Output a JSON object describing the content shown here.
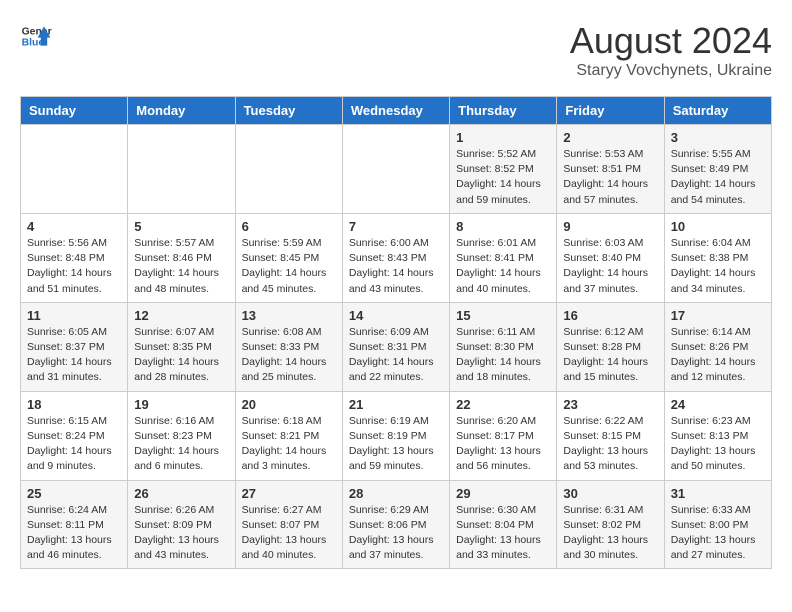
{
  "header": {
    "logo_line1": "General",
    "logo_line2": "Blue",
    "month": "August 2024",
    "location": "Staryy Vovchynets, Ukraine"
  },
  "weekdays": [
    "Sunday",
    "Monday",
    "Tuesday",
    "Wednesday",
    "Thursday",
    "Friday",
    "Saturday"
  ],
  "weeks": [
    [
      {
        "day": "",
        "info": ""
      },
      {
        "day": "",
        "info": ""
      },
      {
        "day": "",
        "info": ""
      },
      {
        "day": "",
        "info": ""
      },
      {
        "day": "1",
        "info": "Sunrise: 5:52 AM\nSunset: 8:52 PM\nDaylight: 14 hours\nand 59 minutes."
      },
      {
        "day": "2",
        "info": "Sunrise: 5:53 AM\nSunset: 8:51 PM\nDaylight: 14 hours\nand 57 minutes."
      },
      {
        "day": "3",
        "info": "Sunrise: 5:55 AM\nSunset: 8:49 PM\nDaylight: 14 hours\nand 54 minutes."
      }
    ],
    [
      {
        "day": "4",
        "info": "Sunrise: 5:56 AM\nSunset: 8:48 PM\nDaylight: 14 hours\nand 51 minutes."
      },
      {
        "day": "5",
        "info": "Sunrise: 5:57 AM\nSunset: 8:46 PM\nDaylight: 14 hours\nand 48 minutes."
      },
      {
        "day": "6",
        "info": "Sunrise: 5:59 AM\nSunset: 8:45 PM\nDaylight: 14 hours\nand 45 minutes."
      },
      {
        "day": "7",
        "info": "Sunrise: 6:00 AM\nSunset: 8:43 PM\nDaylight: 14 hours\nand 43 minutes."
      },
      {
        "day": "8",
        "info": "Sunrise: 6:01 AM\nSunset: 8:41 PM\nDaylight: 14 hours\nand 40 minutes."
      },
      {
        "day": "9",
        "info": "Sunrise: 6:03 AM\nSunset: 8:40 PM\nDaylight: 14 hours\nand 37 minutes."
      },
      {
        "day": "10",
        "info": "Sunrise: 6:04 AM\nSunset: 8:38 PM\nDaylight: 14 hours\nand 34 minutes."
      }
    ],
    [
      {
        "day": "11",
        "info": "Sunrise: 6:05 AM\nSunset: 8:37 PM\nDaylight: 14 hours\nand 31 minutes."
      },
      {
        "day": "12",
        "info": "Sunrise: 6:07 AM\nSunset: 8:35 PM\nDaylight: 14 hours\nand 28 minutes."
      },
      {
        "day": "13",
        "info": "Sunrise: 6:08 AM\nSunset: 8:33 PM\nDaylight: 14 hours\nand 25 minutes."
      },
      {
        "day": "14",
        "info": "Sunrise: 6:09 AM\nSunset: 8:31 PM\nDaylight: 14 hours\nand 22 minutes."
      },
      {
        "day": "15",
        "info": "Sunrise: 6:11 AM\nSunset: 8:30 PM\nDaylight: 14 hours\nand 18 minutes."
      },
      {
        "day": "16",
        "info": "Sunrise: 6:12 AM\nSunset: 8:28 PM\nDaylight: 14 hours\nand 15 minutes."
      },
      {
        "day": "17",
        "info": "Sunrise: 6:14 AM\nSunset: 8:26 PM\nDaylight: 14 hours\nand 12 minutes."
      }
    ],
    [
      {
        "day": "18",
        "info": "Sunrise: 6:15 AM\nSunset: 8:24 PM\nDaylight: 14 hours\nand 9 minutes."
      },
      {
        "day": "19",
        "info": "Sunrise: 6:16 AM\nSunset: 8:23 PM\nDaylight: 14 hours\nand 6 minutes."
      },
      {
        "day": "20",
        "info": "Sunrise: 6:18 AM\nSunset: 8:21 PM\nDaylight: 14 hours\nand 3 minutes."
      },
      {
        "day": "21",
        "info": "Sunrise: 6:19 AM\nSunset: 8:19 PM\nDaylight: 13 hours\nand 59 minutes."
      },
      {
        "day": "22",
        "info": "Sunrise: 6:20 AM\nSunset: 8:17 PM\nDaylight: 13 hours\nand 56 minutes."
      },
      {
        "day": "23",
        "info": "Sunrise: 6:22 AM\nSunset: 8:15 PM\nDaylight: 13 hours\nand 53 minutes."
      },
      {
        "day": "24",
        "info": "Sunrise: 6:23 AM\nSunset: 8:13 PM\nDaylight: 13 hours\nand 50 minutes."
      }
    ],
    [
      {
        "day": "25",
        "info": "Sunrise: 6:24 AM\nSunset: 8:11 PM\nDaylight: 13 hours\nand 46 minutes."
      },
      {
        "day": "26",
        "info": "Sunrise: 6:26 AM\nSunset: 8:09 PM\nDaylight: 13 hours\nand 43 minutes."
      },
      {
        "day": "27",
        "info": "Sunrise: 6:27 AM\nSunset: 8:07 PM\nDaylight: 13 hours\nand 40 minutes."
      },
      {
        "day": "28",
        "info": "Sunrise: 6:29 AM\nSunset: 8:06 PM\nDaylight: 13 hours\nand 37 minutes."
      },
      {
        "day": "29",
        "info": "Sunrise: 6:30 AM\nSunset: 8:04 PM\nDaylight: 13 hours\nand 33 minutes."
      },
      {
        "day": "30",
        "info": "Sunrise: 6:31 AM\nSunset: 8:02 PM\nDaylight: 13 hours\nand 30 minutes."
      },
      {
        "day": "31",
        "info": "Sunrise: 6:33 AM\nSunset: 8:00 PM\nDaylight: 13 hours\nand 27 minutes."
      }
    ]
  ]
}
